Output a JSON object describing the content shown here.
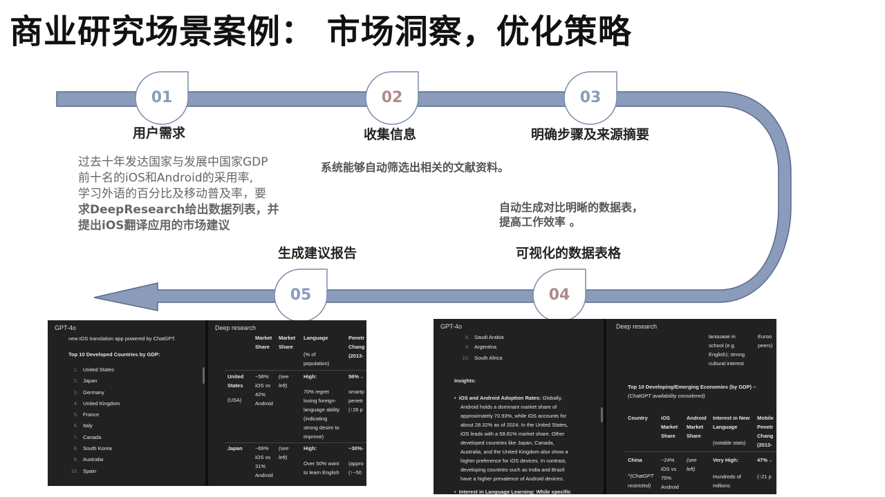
{
  "title": "商业研究场景案例： 市场洞察，优化策略",
  "colors": {
    "flow": "#8a9bbb",
    "flow_stroke": "#5a6a8a",
    "num_blue": "#8a9bbb",
    "num_red": "#b08a8c"
  },
  "steps": [
    {
      "num": "01",
      "title": "用户需求"
    },
    {
      "num": "02",
      "title": "收集信息"
    },
    {
      "num": "03",
      "title": "明确步骤及来源摘要"
    },
    {
      "num": "04",
      "title": "可视化的数据表格"
    },
    {
      "num": "05",
      "title": "生成建议报告"
    }
  ],
  "desc1": {
    "line1": "过去十年发达国家与发展中国家GDP",
    "line2": "前十名的iOS和Android的采用率,",
    "line3": "学习外语的百分比及移动普及率，要",
    "line4": "求DeepResearch给出数据列表，并",
    "line5": "提出iOS翻译应用的市场建议"
  },
  "desc2": "系统能够自动筛选出相关的文献资料。",
  "desc3": {
    "line1": "自动生成对比明晰的数据表，",
    "line2": "提高工作效率 。"
  },
  "shot1": {
    "left_title": "GPT-4o",
    "right_title": "Deep research",
    "intro": "new iOS translation app powered by ChatGPT.",
    "heading": "Top 10 Developed Countries by GDP:",
    "countries": [
      {
        "n": "1.",
        "name": "United States"
      },
      {
        "n": "2.",
        "name": "Japan"
      },
      {
        "n": "3.",
        "name": "Germany"
      },
      {
        "n": "4.",
        "name": "United Kingdom"
      },
      {
        "n": "5.",
        "name": "France"
      },
      {
        "n": "6.",
        "name": "Italy"
      },
      {
        "n": "7.",
        "name": "Canada"
      },
      {
        "n": "8.",
        "name": "South Korea"
      },
      {
        "n": "9.",
        "name": "Australia"
      },
      {
        "n": "10.",
        "name": "Spain"
      }
    ],
    "table": {
      "h1a": "Market",
      "h1b": "Share",
      "h2a": "Market",
      "h2b": "Share",
      "h3": "Language",
      "h3b": "(% of",
      "h3c": "population)",
      "h4a": "Penetr",
      "h4b": "Chang",
      "h4c": "(2013-",
      "r1": {
        "c1a": "United",
        "c1b": "States",
        "c1c": "(USA)",
        "c2a": "~58%",
        "c2b": "iOS vs",
        "c2c": "42%",
        "c2d": "Android",
        "c3a": "(see",
        "c3b": "left)",
        "c4a": "High:",
        "c4b": "70% regret",
        "c4c": "losing foreign-",
        "c4d": "language ability",
        "c4e": "(indicating",
        "c4f": "strong desire to",
        "c4g": "improve)",
        "c5a": "56%→",
        "c5b": "smartp",
        "c5c": "penetr",
        "c5d": "(↑26 p"
      },
      "r2": {
        "c1a": "Japan",
        "c2a": "~69%",
        "c2b": "iOS vs",
        "c2c": "31%",
        "c2d": "Android",
        "c3a": "(see",
        "c3b": "left)",
        "c4a": "High:",
        "c4b": "Over 50% want",
        "c4c": "to learn English",
        "c5a": "~30%-",
        "c5b": "(appro",
        "c5c": "(↑~50"
      }
    }
  },
  "shot2": {
    "left_title": "GPT-4o",
    "right_title": "Deep research",
    "top_items": [
      {
        "n": "8.",
        "name": "Saudi Arabia"
      },
      {
        "n": "9.",
        "name": "Argentina"
      },
      {
        "n": "10.",
        "name": "South Africa"
      }
    ],
    "insights": "Insights:",
    "bullet_head": "iOS and Android Adoption Rates:",
    "bullet_lines": [
      "Globally,",
      "Android holds a dominant market share of",
      "approximately 70.93%, while iOS accounts for",
      "about 28.32% as of 2024. In the United States,",
      "iOS leads with a 58.81% market share. Other",
      "developed countries like Japan, Canada,",
      "Australia, and the United Kingdom also show a",
      "higher preference for iOS devices. In contrast,",
      "developing countries such as India and Brazil",
      "have a higher prevalence of Android devices."
    ],
    "bullet2": "Interest in Language Learning: While specific",
    "right_top": [
      "language in",
      "school (e.g.",
      "English); strong",
      "cultural interest"
    ],
    "right_top2": [
      "Europ",
      "peers)"
    ],
    "heading": "Top 10 Developing/Emerging Economies (by GDP) –",
    "heading2": "(ChatGPT availability considered)",
    "cols": {
      "c1": "Country",
      "c2a": "iOS",
      "c2b": "Market",
      "c2c": "Share",
      "c3a": "Android",
      "c3b": "Market",
      "c3c": "Share",
      "c4a": "Interest in New",
      "c4b": "Language",
      "c4c": "(notable stats)",
      "c5a": "Mobile",
      "c5b": "Penetr",
      "c5c": "Chang",
      "c5d": "(2013-"
    },
    "row": {
      "c1a": "China",
      "c1b": "^(ChatGPT",
      "c1c": "restricted)",
      "c2a": "~24%",
      "c2b": "iOS vs",
      "c2c": "75%",
      "c2d": "Android",
      "c3a": "(see",
      "c3b": "left)",
      "c4a": "Very High:",
      "c4b": "Hundreds of",
      "c4c": "millions",
      "c5a": "47%→",
      "c5b": "(↑21 p"
    }
  }
}
